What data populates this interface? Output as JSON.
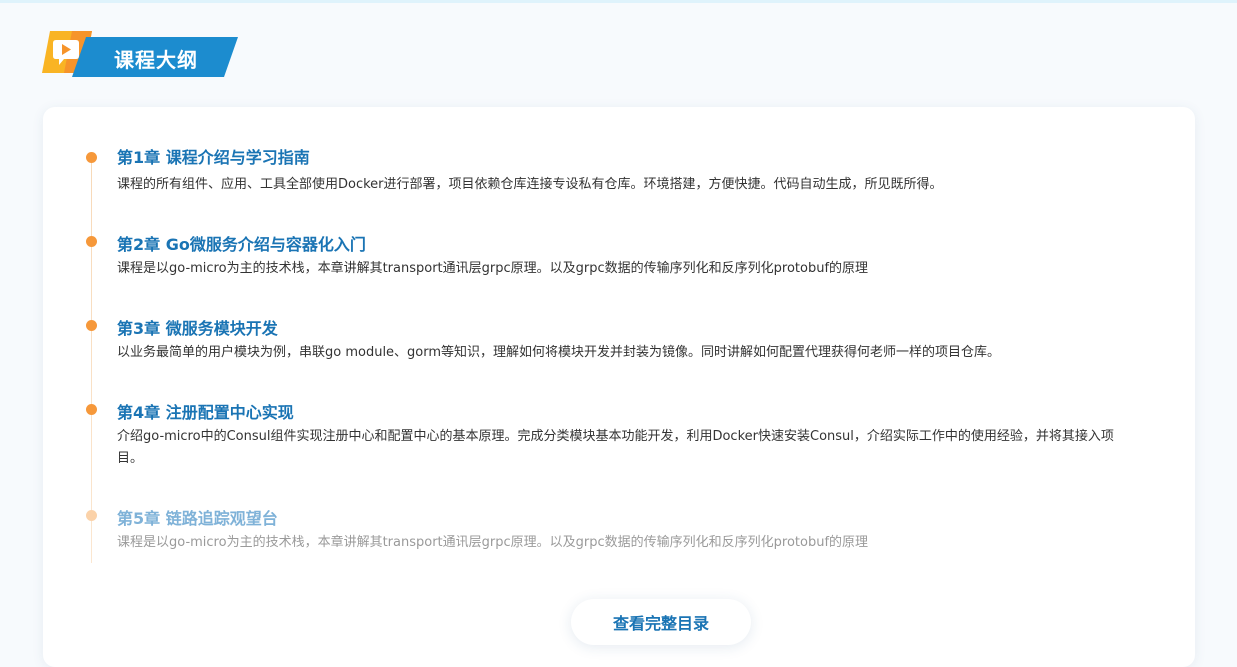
{
  "header": {
    "title": "课程大纲",
    "logo_icon": "play-badge-icon",
    "colors": {
      "logo_yellow": "#f9b424",
      "logo_orange": "#f6942a",
      "banner_blue": "#1c8ccf"
    }
  },
  "chapters": [
    {
      "title": "第1章 课程介绍与学习指南",
      "description": "课程的所有组件、应用、工具全部使用Docker进行部署，项目依赖仓库连接专设私有仓库。环境搭建，方便快捷。代码自动生成，所见既所得。"
    },
    {
      "title": "第2章 Go微服务介绍与容器化入门",
      "description": "课程是以go-micro为主的技术栈，本章讲解其transport通讯层grpc原理。以及grpc数据的传输序列化和反序列化protobuf的原理"
    },
    {
      "title": "第3章 微服务模块开发",
      "description": "以业务最简单的用户模块为例，串联go module、gorm等知识，理解如何将模块开发并封装为镜像。同时讲解如何配置代理获得何老师一样的项目仓库。"
    },
    {
      "title": "第4章 注册配置中心实现",
      "description": "介绍go-micro中的Consul组件实现注册中心和配置中心的基本原理。完成分类模块基本功能开发，利用Docker快速安装Consul，介绍实际工作中的使用经验，并将其接入项目。"
    },
    {
      "title": "第5章 链路追踪观望台",
      "description": "课程是以go-micro为主的技术栈，本章讲解其transport通讯层grpc原理。以及grpc数据的传输序列化和反序列化protobuf的原理"
    }
  ],
  "full_catalog_button": {
    "label": "查看完整目录"
  },
  "colors": {
    "accent_orange": "#f6983a",
    "title_blue": "#1a74b4"
  }
}
